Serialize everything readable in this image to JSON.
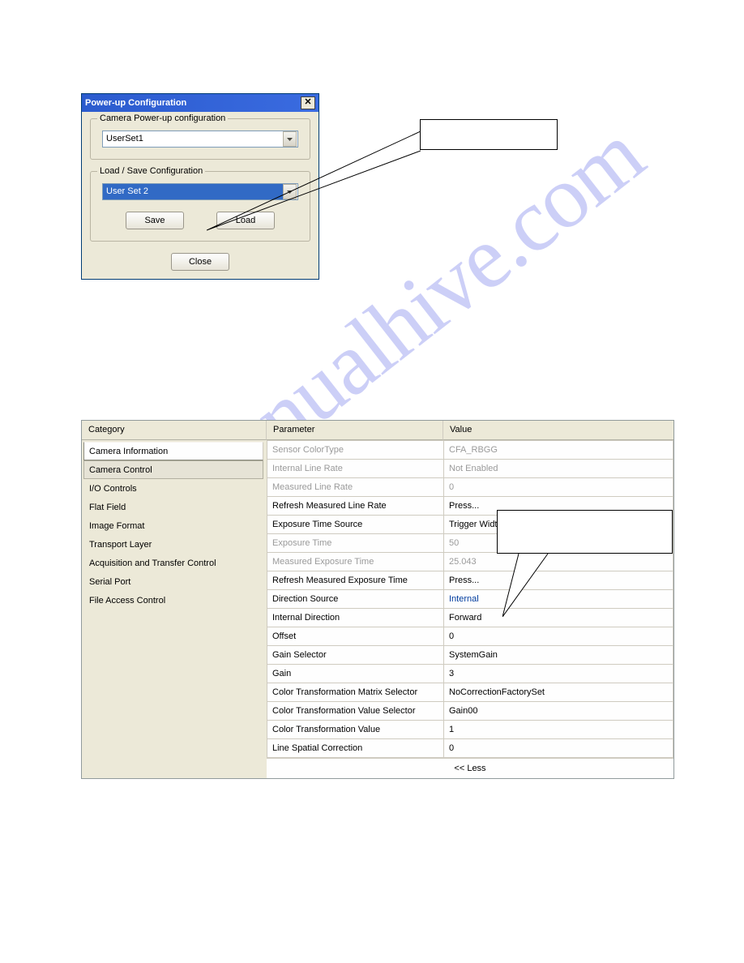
{
  "watermark": "manualhive.com",
  "dialog": {
    "title": "Power-up Configuration",
    "group_powerup": {
      "legend": "Camera Power-up configuration",
      "combo_value": "UserSet1"
    },
    "group_loadsave": {
      "legend": "Load / Save Configuration",
      "combo_value": "User Set 2",
      "save_label": "Save",
      "load_label": "Load"
    },
    "close_label": "Close"
  },
  "grid": {
    "headers": {
      "category": "Category",
      "parameter": "Parameter",
      "value": "Value"
    },
    "categories": [
      {
        "label": "Camera Information",
        "state": "sel"
      },
      {
        "label": "Camera Control",
        "state": "active"
      },
      {
        "label": "I/O Controls",
        "state": ""
      },
      {
        "label": "Flat Field",
        "state": ""
      },
      {
        "label": "Image Format",
        "state": ""
      },
      {
        "label": "Transport Layer",
        "state": ""
      },
      {
        "label": "Acquisition and Transfer Control",
        "state": ""
      },
      {
        "label": "Serial Port",
        "state": ""
      },
      {
        "label": "File Access Control",
        "state": ""
      }
    ],
    "rows": [
      {
        "param": "Sensor ColorType",
        "value": "CFA_RBGG",
        "disabled": true
      },
      {
        "param": "Internal Line Rate",
        "value": "Not Enabled",
        "disabled": true
      },
      {
        "param": "Measured Line Rate",
        "value": "0",
        "disabled": true
      },
      {
        "param": "Refresh Measured Line Rate",
        "value": "Press...",
        "disabled": false
      },
      {
        "param": "Exposure Time Source",
        "value": "Trigger Width",
        "disabled": false
      },
      {
        "param": "Exposure Time",
        "value": "50",
        "disabled": true
      },
      {
        "param": "Measured Exposure Time",
        "value": "25.043",
        "disabled": true
      },
      {
        "param": "Refresh Measured Exposure Time",
        "value": "Press...",
        "disabled": false
      },
      {
        "param": "Direction Source",
        "value": "Internal",
        "disabled": false,
        "link": true
      },
      {
        "param": "Internal Direction",
        "value": "Forward",
        "disabled": false
      },
      {
        "param": "Offset",
        "value": "0",
        "disabled": false
      },
      {
        "param": "Gain Selector",
        "value": "SystemGain",
        "disabled": false
      },
      {
        "param": "Gain",
        "value": "3",
        "disabled": false
      },
      {
        "param": "Color Transformation Matrix Selector",
        "value": "NoCorrectionFactorySet",
        "disabled": false
      },
      {
        "param": "Color Transformation Value Selector",
        "value": "Gain00",
        "disabled": false
      },
      {
        "param": "Color Transformation Value",
        "value": "1",
        "disabled": false
      },
      {
        "param": "Line Spatial Correction",
        "value": "0",
        "disabled": false
      }
    ],
    "less_label": "<< Less"
  }
}
